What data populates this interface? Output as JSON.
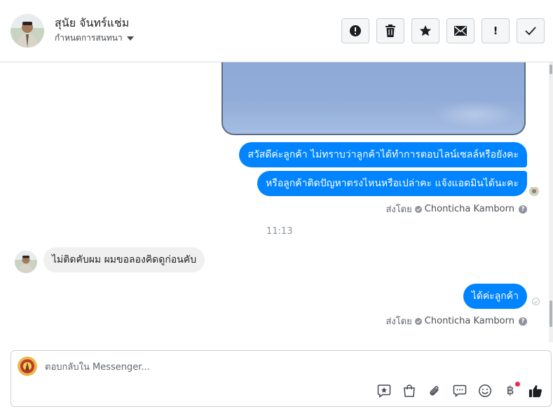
{
  "header": {
    "contact_name": "สุนัย จันทร์แช่ม",
    "subtitle": "กำหนดการสนทนา",
    "actions": [
      {
        "icon": "alert-circle-icon",
        "label": ""
      },
      {
        "icon": "trash-icon",
        "label": ""
      },
      {
        "icon": "star-icon",
        "label": ""
      },
      {
        "icon": "envelope-icon",
        "label": ""
      },
      {
        "icon": "exclamation-icon",
        "label": "!"
      },
      {
        "icon": "checkmark-icon",
        "label": ""
      }
    ]
  },
  "conversation": {
    "messages": [
      {
        "direction": "out",
        "text": "สวัสดีค่ะลูกค้า ไม่ทราบว่าลูกค้าได้ทำการตอบไลน์เซลล์หรือยังคะ"
      },
      {
        "direction": "out",
        "text": "หรือลูกค้าติดปัญหาตรงไหนหรือเปล่าคะ แจ้งแอดมินได้นะคะ"
      },
      {
        "direction": "in",
        "text": "ไม่ติดคับผม ผมขอลองคิดดูก่อนคับ"
      },
      {
        "direction": "out",
        "text": "ได้ค่ะลูกค้า"
      }
    ],
    "sent_by_label": "ส่งโดย",
    "sent_by_name": "Chonticha Kamborn",
    "timestamp": "11:13"
  },
  "composer": {
    "placeholder": "ตอบกลับใน Messenger...",
    "tools": [
      "star-badge-icon",
      "shopping-bag-icon",
      "paperclip-icon",
      "speech-bubble-icon",
      "smiley-icon",
      "baht-icon",
      "thumbs-up-icon"
    ],
    "baht_symbol": "฿"
  },
  "colors": {
    "outgoing_bubble": "#0084ff",
    "incoming_bubble": "#f1f0f0",
    "notification_dot": "#f02849"
  }
}
